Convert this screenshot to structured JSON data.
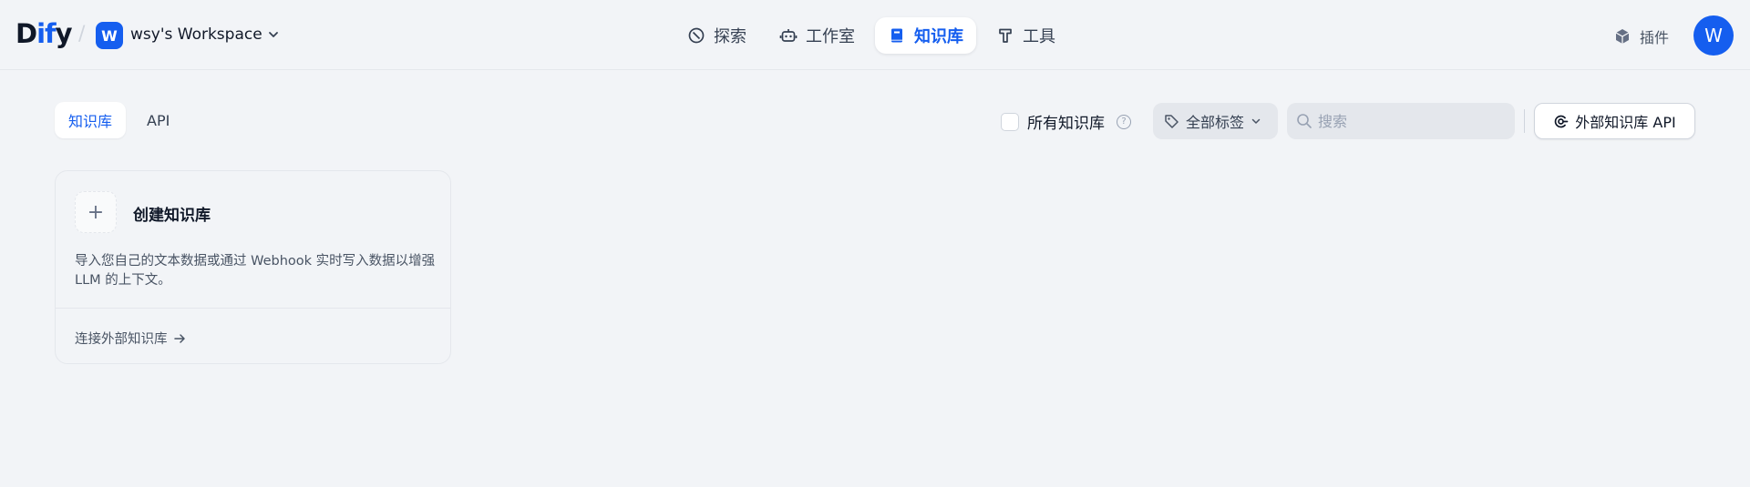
{
  "header": {
    "logo": {
      "part1": "D",
      "part2": "if",
      "part3": "y"
    },
    "workspace": {
      "initial": "W",
      "name": "wsy's Workspace"
    },
    "nav": [
      {
        "label": "探索",
        "icon": "compass-icon"
      },
      {
        "label": "工作室",
        "icon": "robot-icon"
      },
      {
        "label": "知识库",
        "icon": "book-icon",
        "active": true
      },
      {
        "label": "工具",
        "icon": "hammer-icon"
      }
    ],
    "plugins_label": "插件",
    "user_initial": "W"
  },
  "tabs": [
    {
      "label": "知识库",
      "active": true
    },
    {
      "label": "API",
      "active": false
    }
  ],
  "filters": {
    "all_kb_label": "所有知识库",
    "all_kb_checked": false,
    "tag_select_label": "全部标签",
    "search_placeholder": "搜索",
    "external_api_label": "外部知识库 API"
  },
  "create_card": {
    "title": "创建知识库",
    "description": "导入您自己的文本数据或通过 Webhook 实时写入数据以增强 LLM 的上下文。",
    "link_label": "连接外部知识库"
  },
  "colors": {
    "accent": "#155eef",
    "background": "#f2f4f7"
  }
}
